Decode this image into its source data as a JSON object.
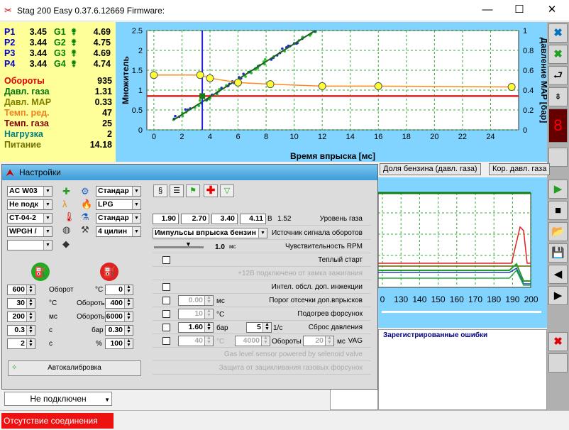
{
  "title": {
    "app": "Stag 200 Easy 0.37.6.12669 Firmware:",
    "min": "—",
    "max": "☐",
    "close": "✕"
  },
  "injectors": [
    {
      "p": "P1",
      "pv": "3.45",
      "g": "G1",
      "gv": "4.69"
    },
    {
      "p": "P2",
      "pv": "3.44",
      "g": "G2",
      "gv": "4.75"
    },
    {
      "p": "P3",
      "pv": "3.44",
      "g": "G3",
      "gv": "4.69"
    },
    {
      "p": "P4",
      "pv": "3.44",
      "g": "G4",
      "gv": "4.74"
    }
  ],
  "params": [
    {
      "label": "Обороты",
      "value": "935",
      "color": "#e00000"
    },
    {
      "label": "Давл. газа",
      "value": "1.31",
      "color": "#007000"
    },
    {
      "label": "Давл. MAP",
      "value": "0.33",
      "color": "#808000"
    },
    {
      "label": "Темп. ред.",
      "value": "47",
      "color": "#f08020"
    },
    {
      "label": "Темп. газа",
      "value": "25",
      "color": "#800000"
    },
    {
      "label": "Нагрузка",
      "value": "2",
      "color": "#008080"
    },
    {
      "label": "Питание",
      "value": "14.18",
      "color": "#707000"
    }
  ],
  "chart_data": {
    "type": "scatter",
    "xlabel": "Время впрыска [мс]",
    "ylabel": "Множитель",
    "y2label": "Давление MAP [бар]",
    "xticks": [
      "0",
      "2",
      "4",
      "6",
      "8",
      "10",
      "12",
      "14",
      "16",
      "18",
      "20",
      "22",
      "24"
    ],
    "yticks": [
      "0",
      "0.5",
      "1",
      "1.5",
      "2",
      "2.5"
    ],
    "y2ticks": [
      "0",
      "0.2",
      "0.4",
      "0.6",
      "0.8",
      "1"
    ],
    "xlim": [
      -0.5,
      26
    ],
    "ylim": [
      0,
      2.5
    ],
    "multiplier_points": [
      {
        "x": 0,
        "y": 1.38
      },
      {
        "x": 3.3,
        "y": 1.38
      },
      {
        "x": 4,
        "y": 1.3
      },
      {
        "x": 6,
        "y": 1.19
      },
      {
        "x": 8.3,
        "y": 1.15
      },
      {
        "x": 12,
        "y": 1.1
      },
      {
        "x": 16,
        "y": 1.1
      },
      {
        "x": 25.5,
        "y": 1.08
      }
    ],
    "reference_line_y": 0.85,
    "marker_x": 3.45,
    "calibration_from": {
      "x": 1.4,
      "y": 0.25
    },
    "calibration_to": {
      "x": 11.5,
      "y": 2.5
    },
    "colors": {
      "multiplier": "#ff8c1a",
      "reference": "#e02020",
      "marker": "#2020e0",
      "points_blue": "#2030c0",
      "points_green": "#20c020"
    }
  },
  "tabs": [
    "Доля бензина (давл. газа)",
    "Кор. давл. газа"
  ],
  "osc": {
    "ticks": [
      "0",
      "130",
      "140",
      "150",
      "160",
      "170",
      "180",
      "190",
      "200"
    ]
  },
  "errors": {
    "title": "Зарегистрированные ошибки"
  },
  "settings": {
    "title": "Настройки",
    "left_dd": [
      "AC W03",
      "Не подк",
      "CT-04-2",
      "WPGH /",
      ""
    ],
    "right_dd": [
      "Стандар",
      "LPG",
      "Стандар",
      "4 цилин"
    ],
    "rows": [
      {
        "v1": "600",
        "u1": "Оборот",
        "u2": "°C",
        "v2": "0"
      },
      {
        "v1": "30",
        "u1": "°C",
        "u2": "Обороты",
        "v2": "400"
      },
      {
        "v1": "200",
        "u1": "мс",
        "u2": "Обороты",
        "v2": "6000"
      },
      {
        "v1": "0.3",
        "u1": "с",
        "u2": "бар",
        "v2": "0.30"
      },
      {
        "v1": "2",
        "u1": "с",
        "u2": "%",
        "v2": "100"
      }
    ],
    "autocal": "Автокалибровка",
    "gas_levels": [
      "1.90",
      "2.70",
      "3.40",
      "4.11"
    ],
    "gas_unit": "В",
    "gas_value": "1.52",
    "gas_label": "Уровень газа",
    "rpm_source": "Импульсы впрыска бензин",
    "rpm_source_label": "Источник сигнала оборотов",
    "sens_value": "1.0",
    "sens_unit": "мс",
    "sens_label": "Чувствительность RPM",
    "warm_start": "Теплый старт",
    "plus12": "+12В подключено от замка зажигания",
    "intel": "Интел. обсл. доп. инжекции",
    "cutoff_value": "0.00",
    "cutoff_unit": "мс",
    "cutoff_label": "Порог отсечки доп.впрысков",
    "heat_value": "10",
    "heat_unit": "°C",
    "heat_label": "Подогрев форсунок",
    "press_value": "1.60",
    "press_unit": "бар",
    "press_rate": "5",
    "press_rate_unit": "1/с",
    "press_label": "Сброс давления",
    "vag_t": "40",
    "vag_t_unit": "°C",
    "vag_rpm": "4000",
    "vag_rpm_unit": "Обороты",
    "vag_ms": "20",
    "vag_ms_unit": "мс",
    "vag_label": "VAG",
    "sensor_label": "Gas level sensor powered by selenoid valve",
    "protect_label": "Защита от зацикливания газовых форсунок"
  },
  "bottom": {
    "conn_select": "Не подключен",
    "status": "Отсутствие соединения"
  }
}
